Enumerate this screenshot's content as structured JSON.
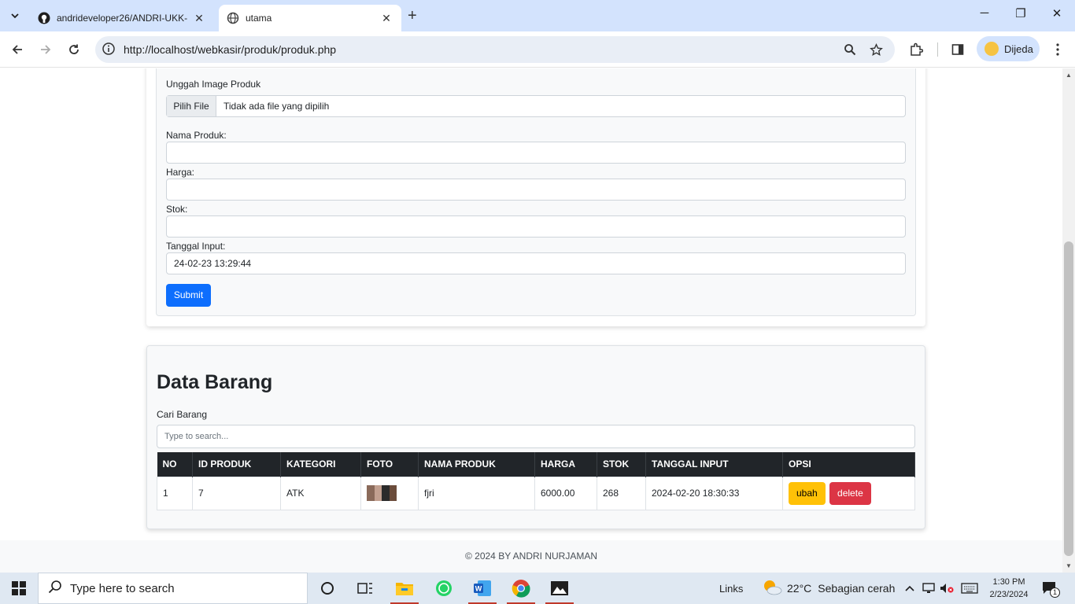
{
  "browser": {
    "tabs": [
      {
        "title": "andrideveloper26/ANDRI-UKK-"
      },
      {
        "title": "utama"
      }
    ],
    "url": "http://localhost/webkasir/produk/produk.php",
    "profile_label": "Dijeda"
  },
  "form": {
    "upload_label": "Unggah Image Produk",
    "file_button": "Pilih File",
    "file_status": "Tidak ada file yang dipilih",
    "nama_label": "Nama Produk:",
    "harga_label": "Harga:",
    "stok_label": "Stok:",
    "tanggal_label": "Tanggal Input:",
    "tanggal_value": "24-02-23 13:29:44",
    "submit_label": "Submit"
  },
  "data_barang": {
    "title": "Data Barang",
    "search_label": "Cari Barang",
    "search_placeholder": "Type to search...",
    "columns": [
      "NO",
      "ID PRODUK",
      "KATEGORI",
      "FOTO",
      "NAMA PRODUK",
      "HARGA",
      "STOK",
      "TANGGAL INPUT",
      "OPSI"
    ],
    "rows": [
      {
        "no": "1",
        "id": "7",
        "kategori": "ATK",
        "nama": "fjri",
        "harga": "6000.00",
        "stok": "268",
        "tanggal": "2024-02-20 18:30:33",
        "ubah": "ubah",
        "delete": "delete"
      }
    ]
  },
  "footer": {
    "text": "© 2024 BY ANDRI NURJAMAN"
  },
  "taskbar": {
    "search_placeholder": "Type here to search",
    "links_label": "Links",
    "weather_temp": "22°C",
    "weather_desc": "Sebagian cerah",
    "time": "1:30 PM",
    "date": "2/23/2024",
    "notif_count": "1"
  },
  "colors": {
    "primary": "#0d6efd",
    "warning": "#ffc107",
    "danger": "#dc3545",
    "table_header": "#212529",
    "tabbar": "#d3e3fd"
  }
}
